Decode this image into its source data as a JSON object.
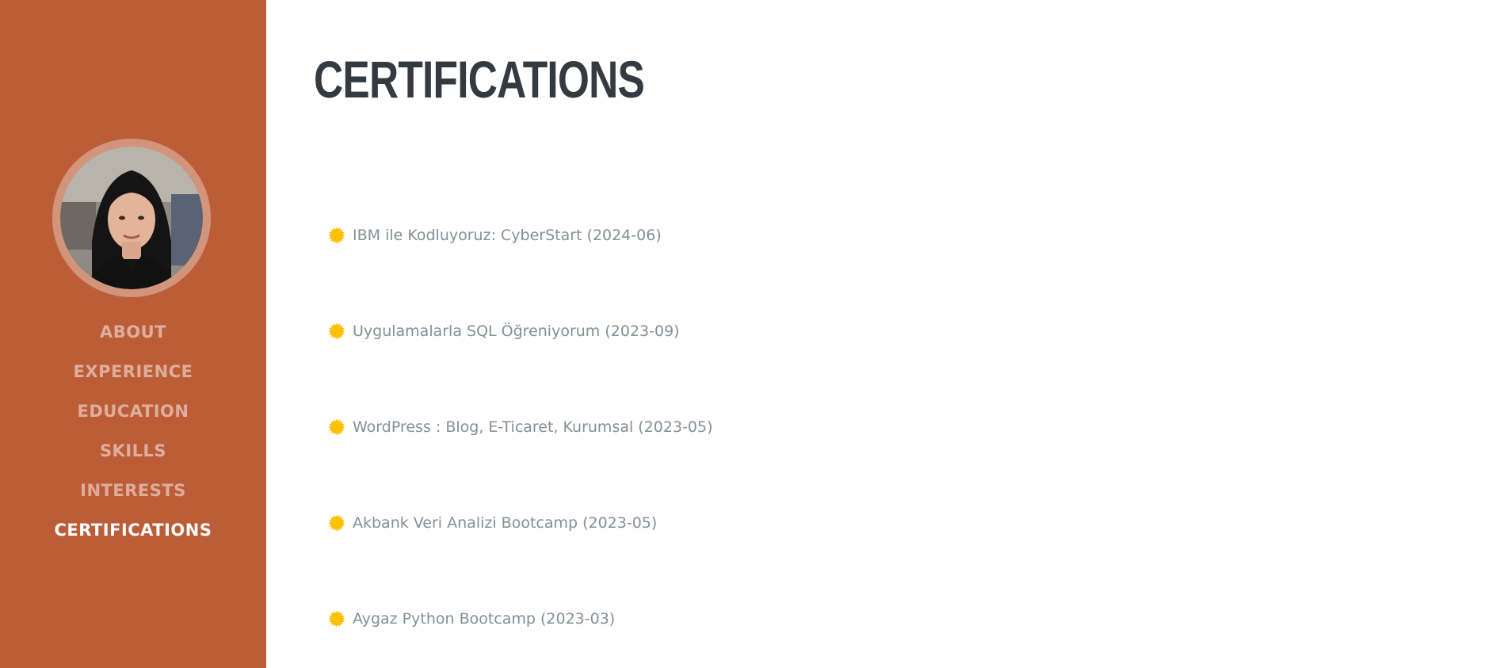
{
  "sidebar": {
    "nav": [
      {
        "label": "ABOUT",
        "active": false
      },
      {
        "label": "EXPERIENCE",
        "active": false
      },
      {
        "label": "EDUCATION",
        "active": false
      },
      {
        "label": "SKILLS",
        "active": false
      },
      {
        "label": "INTERESTS",
        "active": false
      },
      {
        "label": "CERTIFICATIONS",
        "active": true
      }
    ]
  },
  "main": {
    "title": "CERTIFICATIONS",
    "certifications": [
      {
        "text": "IBM ile Kodluyoruz: CyberStart (2024-06)",
        "icon": "certificate-badge-icon"
      },
      {
        "text": "Uygulamalarla SQL Öğreniyorum (2023-09)",
        "icon": "certificate-badge-icon"
      },
      {
        "text": "WordPress : Blog, E-Ticaret, Kurumsal (2023-05)",
        "icon": "certificate-badge-icon"
      },
      {
        "text": "Akbank Veri Analizi Bootcamp (2023-05)",
        "icon": "certificate-badge-icon"
      },
      {
        "text": "Aygaz Python Bootcamp (2023-03)",
        "icon": "certificate-badge-icon"
      }
    ]
  },
  "colors": {
    "sidebar_bg": "#bd5d38",
    "title": "#343a40",
    "item_text": "#868e96",
    "badge": "#ffc107"
  }
}
